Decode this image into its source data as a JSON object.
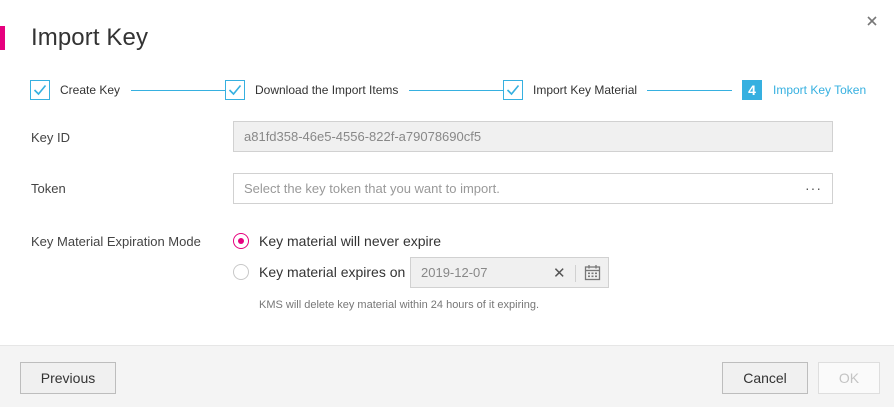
{
  "dialog": {
    "title": "Import Key"
  },
  "steps": [
    {
      "label": "Create Key",
      "state": "done"
    },
    {
      "label": "Download the Import Items",
      "state": "done"
    },
    {
      "label": "Import Key Material",
      "state": "done"
    },
    {
      "label": "Import Key Token",
      "state": "active",
      "number": "4"
    }
  ],
  "form": {
    "key_id_label": "Key ID",
    "key_id_value": "a81fd358-46e5-4556-822f-a79078690cf5",
    "token_label": "Token",
    "token_placeholder": "Select the key token that you want to import.",
    "token_more": "···",
    "expiration_label": "Key Material Expiration Mode",
    "option_never": "Key material will never expire",
    "option_expires": "Key material expires on",
    "expiry_date": "2019-12-07",
    "selected_option": "never",
    "hint": "KMS will delete key material within 24 hours of it expiring."
  },
  "footer": {
    "previous_label": "Previous",
    "cancel_label": "Cancel",
    "ok_label": "OK"
  },
  "colors": {
    "accent": "#e6007e",
    "step_blue": "#36b0e0"
  }
}
